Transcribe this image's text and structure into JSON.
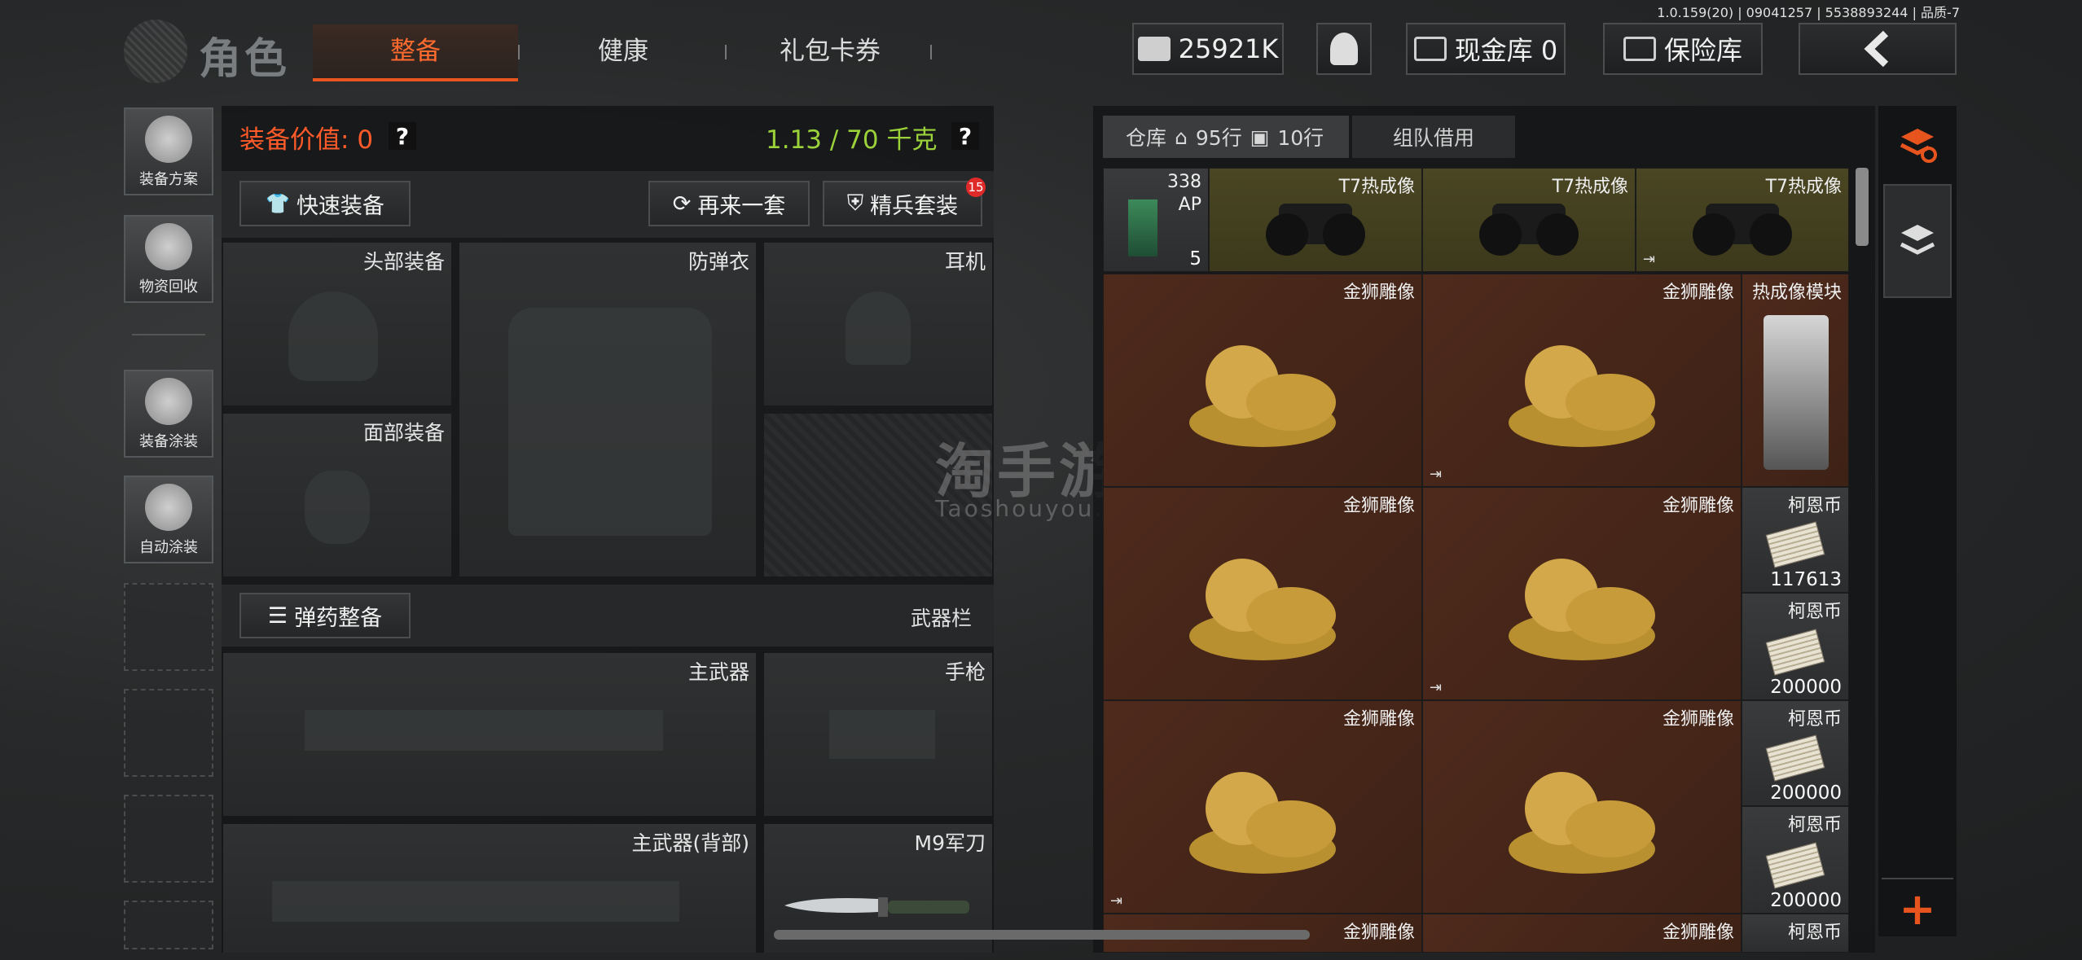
{
  "version": "1.0.159(20) | 09041257 | 5538893244 | 品质-7",
  "header": {
    "title": "角色",
    "tabs": [
      {
        "label": "整备",
        "active": true
      },
      {
        "label": "健康",
        "active": false
      },
      {
        "label": "礼包卡券",
        "active": false
      }
    ],
    "currency": "25921K",
    "cash_vault": "现金库 0",
    "insurance": "保险库",
    "back_icon": "chevron-left-icon"
  },
  "sidebar": {
    "items": [
      {
        "label": "装备方案",
        "icon": "helmet-icon"
      },
      {
        "label": "物资回收",
        "icon": "recycle-icon"
      },
      {
        "label": "装备涂装",
        "icon": "paint-helmet-icon"
      },
      {
        "label": "自动涂装",
        "icon": "auto-paint-icon"
      }
    ]
  },
  "loadout": {
    "value_label": "装备价值:",
    "value": "0",
    "weight": "1.13 / 70 千克",
    "quick_equip": "快速装备",
    "again": "再来一套",
    "elite": "精兵套装",
    "elite_badge": "15",
    "ammo": "弹药整备",
    "weapon_bar": "武器栏",
    "slots": {
      "head": "头部装备",
      "armor": "防弹衣",
      "headset": "耳机",
      "face": "面部装备",
      "primary": "主武器",
      "pistol": "手枪",
      "primary_back": "主武器(背部)",
      "knife": "M9军刀"
    }
  },
  "warehouse": {
    "tab_warehouse": "仓库",
    "rows_home": "95行",
    "rows_bag": "10行",
    "tab_team": "组队借用",
    "items": {
      "ammo_count_top": "338",
      "ammo_type": "AP",
      "ammo_qty": "5",
      "thermal": "T7热成像",
      "lion": "金狮雕像",
      "thermal_module": "热成像模块",
      "coin": "柯恩币",
      "coin_1": "117613",
      "coin_2": "200000",
      "coin_3": "200000",
      "coin_4": "200000"
    }
  },
  "watermark": {
    "cn": "淘手游",
    "en": "Taoshouyou.Com"
  },
  "colors": {
    "accent": "#ff6a2e",
    "weight": "#9bd23a",
    "value": "#ff5a2a",
    "gold_bg": "#4e2a1c"
  }
}
